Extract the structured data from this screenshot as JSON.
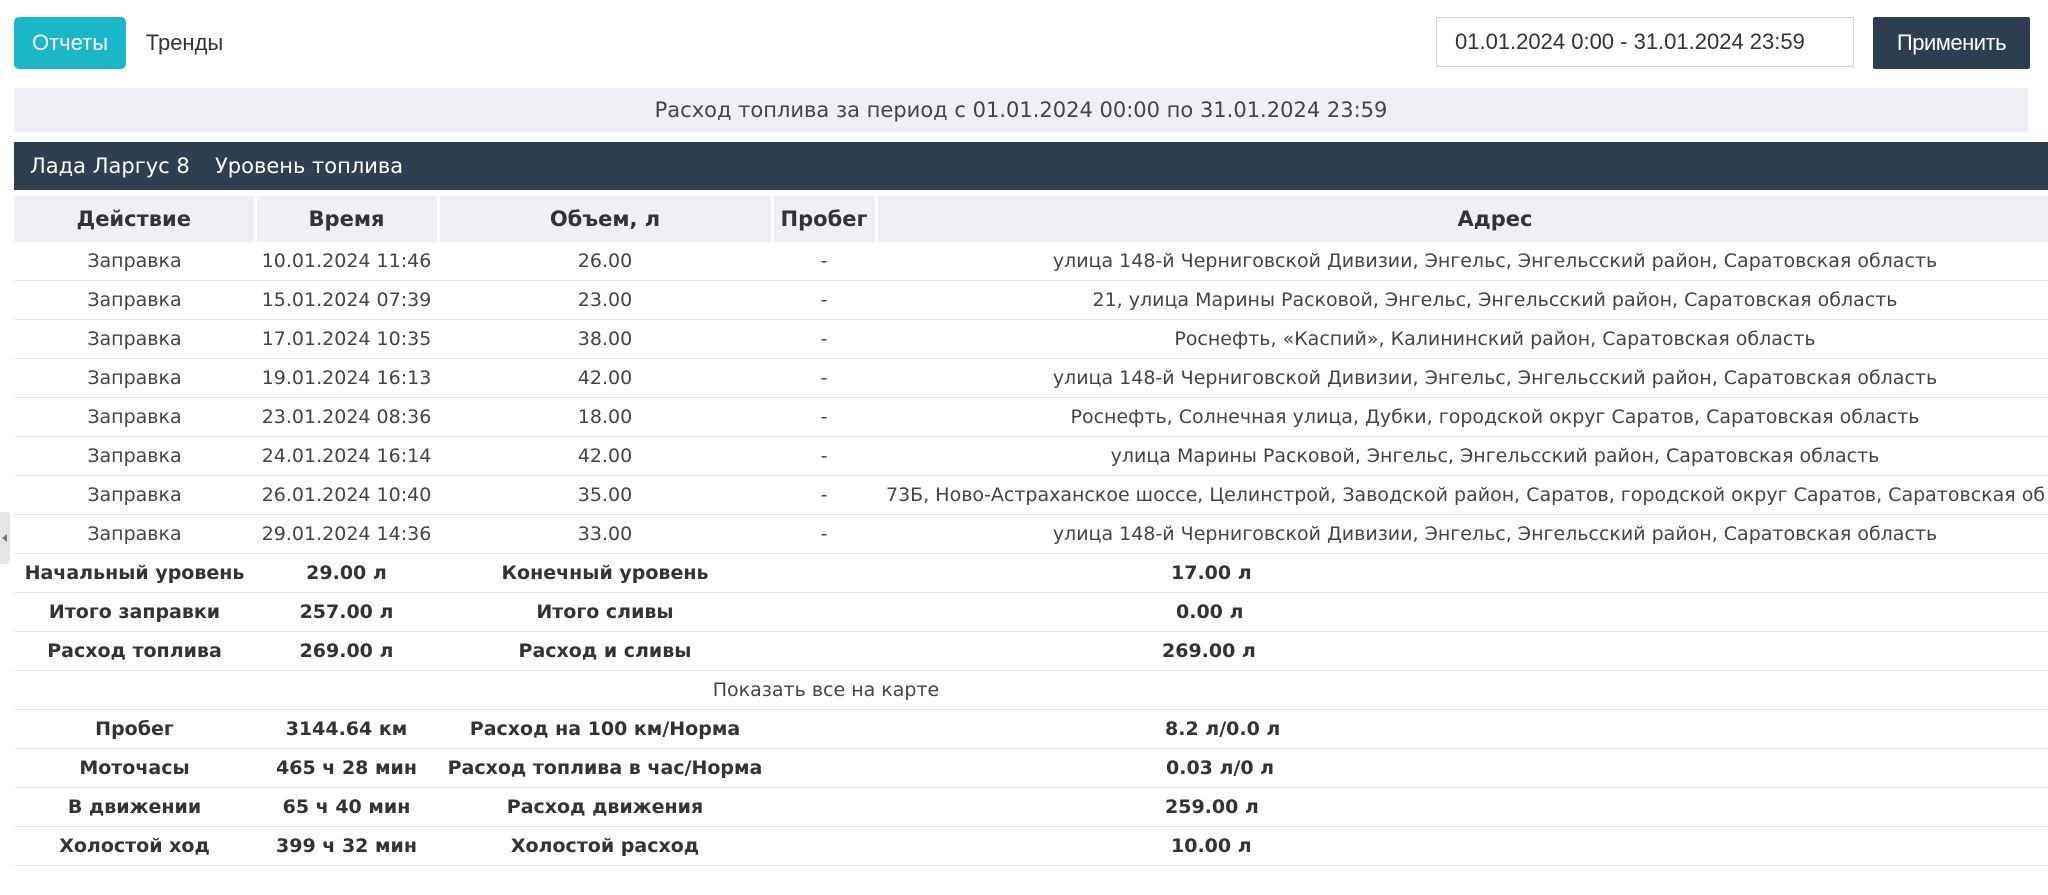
{
  "tabs": {
    "reports": "Отчеты",
    "trends": "Тренды"
  },
  "date_range": {
    "value": "01.01.2024 0:00 - 31.01.2024 23:59"
  },
  "apply_label": "Применить",
  "report_title": "Расход топлива за период с 01.01.2024 00:00 по 31.01.2024 23:59",
  "vehicle": {
    "name": "Лада Ларгус 8",
    "sensor": "Уровень топлива"
  },
  "columns": [
    "Действие",
    "Время",
    "Объем, л",
    "Пробег",
    "Адрес"
  ],
  "rows": [
    {
      "action": "Заправка",
      "time": "10.01.2024 11:46",
      "volume": "26.00",
      "mileage": "-",
      "address": "улица 148-й Черниговской Дивизии, Энгельс, Энгельсский район, Саратовская область"
    },
    {
      "action": "Заправка",
      "time": "15.01.2024 07:39",
      "volume": "23.00",
      "mileage": "-",
      "address": "21, улица Марины Расковой, Энгельс, Энгельсский район, Саратовская область"
    },
    {
      "action": "Заправка",
      "time": "17.01.2024 10:35",
      "volume": "38.00",
      "mileage": "-",
      "address": "Роснефть, «Каспий», Калининский район, Саратовская область"
    },
    {
      "action": "Заправка",
      "time": "19.01.2024 16:13",
      "volume": "42.00",
      "mileage": "-",
      "address": "улица 148-й Черниговской Дивизии, Энгельс, Энгельсский район, Саратовская область"
    },
    {
      "action": "Заправка",
      "time": "23.01.2024 08:36",
      "volume": "18.00",
      "mileage": "-",
      "address": "Роснефть, Солнечная улица, Дубки, городской округ Саратов, Саратовская область"
    },
    {
      "action": "Заправка",
      "time": "24.01.2024 16:14",
      "volume": "42.00",
      "mileage": "-",
      "address": "улица Марины Расковой, Энгельс, Энгельсский район, Саратовская область"
    },
    {
      "action": "Заправка",
      "time": "26.01.2024 10:40",
      "volume": "35.00",
      "mileage": "-",
      "address": "73Б, Ново-Астраханское шоссе, Целинстрой, Заводской район, Саратов, городской округ Саратов, Саратовская об"
    },
    {
      "action": "Заправка",
      "time": "29.01.2024 14:36",
      "volume": "33.00",
      "mileage": "-",
      "address": "улица 148-й Черниговской Дивизии, Энгельс, Энгельсский район, Саратовская область"
    }
  ],
  "summary1": [
    {
      "label": "Начальный уровень",
      "value": "29.00 л",
      "label2": "Конечный уровень",
      "value2": "17.00 л"
    },
    {
      "label": "Итого заправки",
      "value": "257.00 л",
      "label2": "Итого сливы",
      "value2": "0.00 л"
    },
    {
      "label": "Расход топлива",
      "value": "269.00 л",
      "label2": "Расход и сливы",
      "value2": "269.00 л"
    }
  ],
  "show_on_map": "Показать все на карте",
  "summary2": [
    {
      "label": "Пробег",
      "value": "3144.64 км",
      "label2": "Расход на 100 км/Норма",
      "value2": "8.2 л/0.0 л"
    },
    {
      "label": "Моточасы",
      "value": "465 ч 28 мин",
      "label2": "Расход топлива в час/Норма",
      "value2": "0.03 л/0 л"
    },
    {
      "label": "В движении",
      "value": "65 ч 40 мин",
      "label2": "Расход движения",
      "value2": "259.00 л"
    },
    {
      "label": "Холостой ход",
      "value": "399 ч 32 мин",
      "label2": "Холостой расход",
      "value2": "10.00 л"
    }
  ]
}
